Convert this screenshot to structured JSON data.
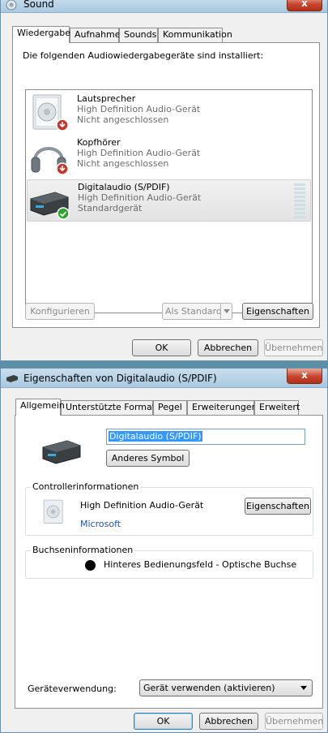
{
  "sound_window": {
    "title": "Sound",
    "close_label": "x",
    "tabs": [
      "Wiedergabe",
      "Aufnahme",
      "Sounds",
      "Kommunikation"
    ],
    "intro_text": "Die folgenden Audiowiedergabegeräte sind installiert:",
    "devices": [
      {
        "name": "Lautsprecher",
        "line1": "High Definition Audio-Gerät",
        "line2": "Nicht angeschlossen",
        "icon": "speaker-icon",
        "status_icon": "disconnected-icon"
      },
      {
        "name": "Kopfhörer",
        "line1": "High Definition Audio-Gerät",
        "line2": "Nicht angeschlossen",
        "icon": "headphones-icon",
        "status_icon": "disconnected-icon"
      },
      {
        "name": "Digitalaudio (S/PDIF)",
        "line1": "High Definition Audio-Gerät",
        "line2": "Standardgerät",
        "icon": "digital-audio-icon",
        "status_icon": "default-check-icon"
      }
    ],
    "buttons": {
      "configure": "Konfigurieren",
      "set_default": "Als Standard",
      "properties": "Eigenschaften",
      "ok": "OK",
      "cancel": "Abbrechen",
      "apply": "Übernehmen"
    }
  },
  "props_window": {
    "title": "Eigenschaften von Digitalaudio (S/PDIF)",
    "close_label": "x",
    "tabs": [
      "Allgemein",
      "Unterstützte Formate",
      "Pegel",
      "Erweiterungen",
      "Erweitert"
    ],
    "device_name_value": "Digitalaudio (S/PDIF)",
    "change_icon_button": "Anderes Symbol",
    "controller": {
      "group_title": "Controllerinformationen",
      "name": "High Definition Audio-Gerät",
      "vendor": "Microsoft",
      "properties_button": "Eigenschaften"
    },
    "jack": {
      "group_title": "Buchseninformationen",
      "text": "Hinteres Bedienungsfeld - Optische Buchse"
    },
    "usage_label": "Geräteverwendung:",
    "usage_value": "Gerät verwenden (aktivieren)",
    "buttons": {
      "ok": "OK",
      "cancel": "Abbrechen",
      "apply": "Übernehmen"
    }
  },
  "colors": {
    "link": "#2255a4",
    "selection": "#3399ff",
    "default_check": "#2aa52a",
    "disconnected": "#c0392b"
  }
}
